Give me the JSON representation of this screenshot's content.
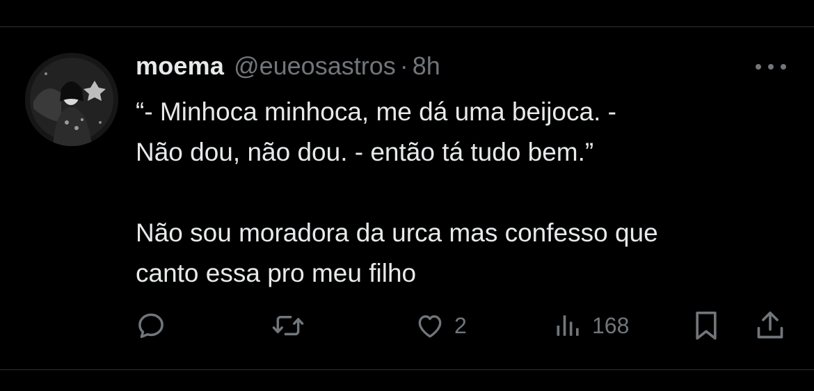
{
  "tweet": {
    "author": {
      "name": "moema",
      "handle": "@eueosastros"
    },
    "separator": "·",
    "time": "8h",
    "text_lines": [
      "“- Minhoca minhoca, me dá uma beijoca. -",
      "Não dou, não dou. - então tá tudo bem.”"
    ],
    "text_lines_2": [
      "Não sou moradora da urca mas confesso que",
      "canto essa pro meu filho"
    ],
    "actions": {
      "reply_icon": "reply-icon",
      "retweet_icon": "retweet-icon",
      "like_icon": "heart-icon",
      "like_count": "2",
      "views_icon": "views-icon",
      "view_count": "168",
      "bookmark_icon": "bookmark-icon",
      "share_icon": "share-icon"
    }
  },
  "colors": {
    "background": "#000000",
    "text": "#e7e9ea",
    "muted": "#71767b",
    "divider": "#2f3336"
  }
}
